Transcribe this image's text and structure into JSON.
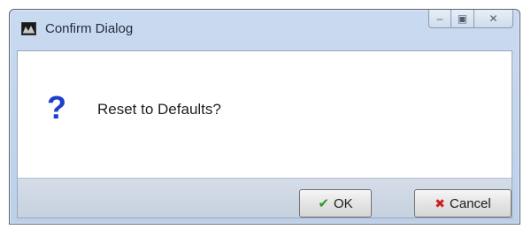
{
  "window": {
    "title": "Confirm Dialog",
    "app_icon": "app-logo-icon",
    "caption_buttons": {
      "minimize": "–",
      "maximize": "▣",
      "close": "✕"
    }
  },
  "dialog": {
    "icon": "question-icon",
    "icon_glyph": "?",
    "icon_color": "#1b3fd0",
    "message": "Reset to Defaults?"
  },
  "buttons": {
    "ok": {
      "label": "OK",
      "icon": "check-icon",
      "glyph": "✔",
      "color": "#2a9a2a"
    },
    "cancel": {
      "label": "Cancel",
      "icon": "x-icon",
      "glyph": "✖",
      "color": "#d11c1c"
    }
  }
}
